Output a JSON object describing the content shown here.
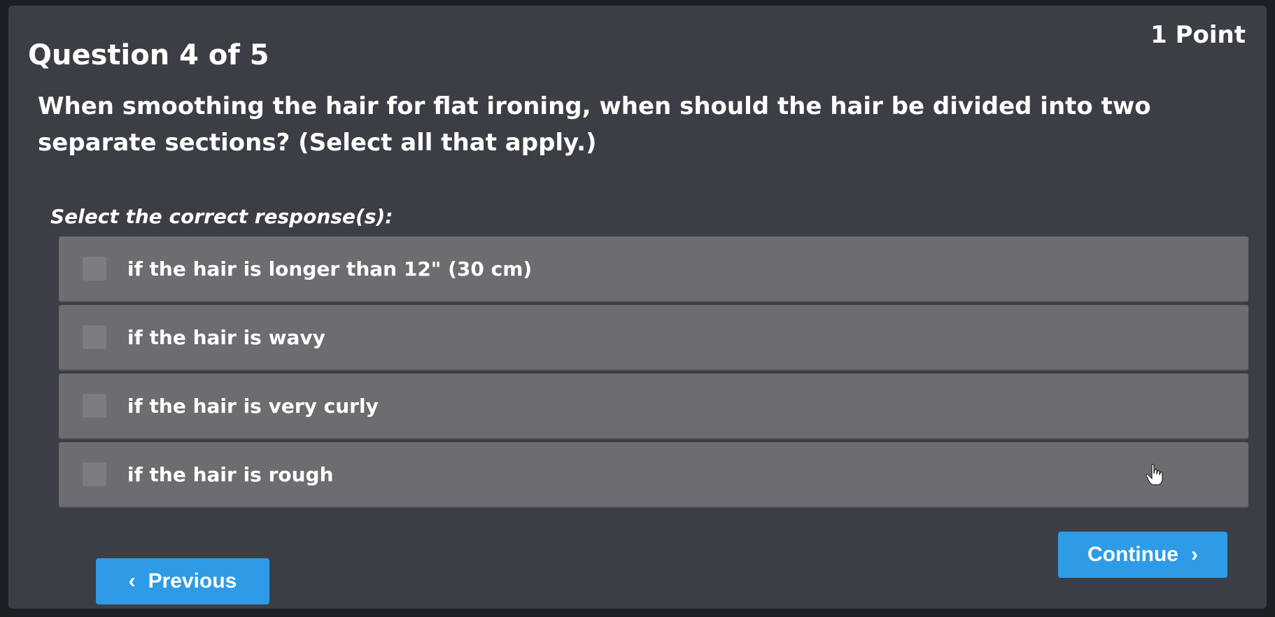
{
  "header": {
    "points": "1 Point",
    "question_number": "Question 4 of 5"
  },
  "question": {
    "text": "When smoothing the hair for flat ironing, when should the hair be divided into two separate sections? (Select all that apply.)",
    "instruction": "Select the correct response(s):"
  },
  "options": [
    {
      "label": "if the hair is longer than 12\" (30 cm)",
      "checked": false
    },
    {
      "label": "if the hair is wavy",
      "checked": false
    },
    {
      "label": "if the hair is very curly",
      "checked": false
    },
    {
      "label": "if the hair is rough",
      "checked": false
    }
  ],
  "navigation": {
    "previous_label": "Previous",
    "continue_label": "Continue"
  },
  "icons": {
    "previous": "chevron-left-icon",
    "continue": "chevron-right-icon",
    "cursor": "hand-pointer-icon"
  },
  "colors": {
    "accent": "#2f9be6",
    "panel": "#3b3f45",
    "option": "#6b6d70"
  }
}
